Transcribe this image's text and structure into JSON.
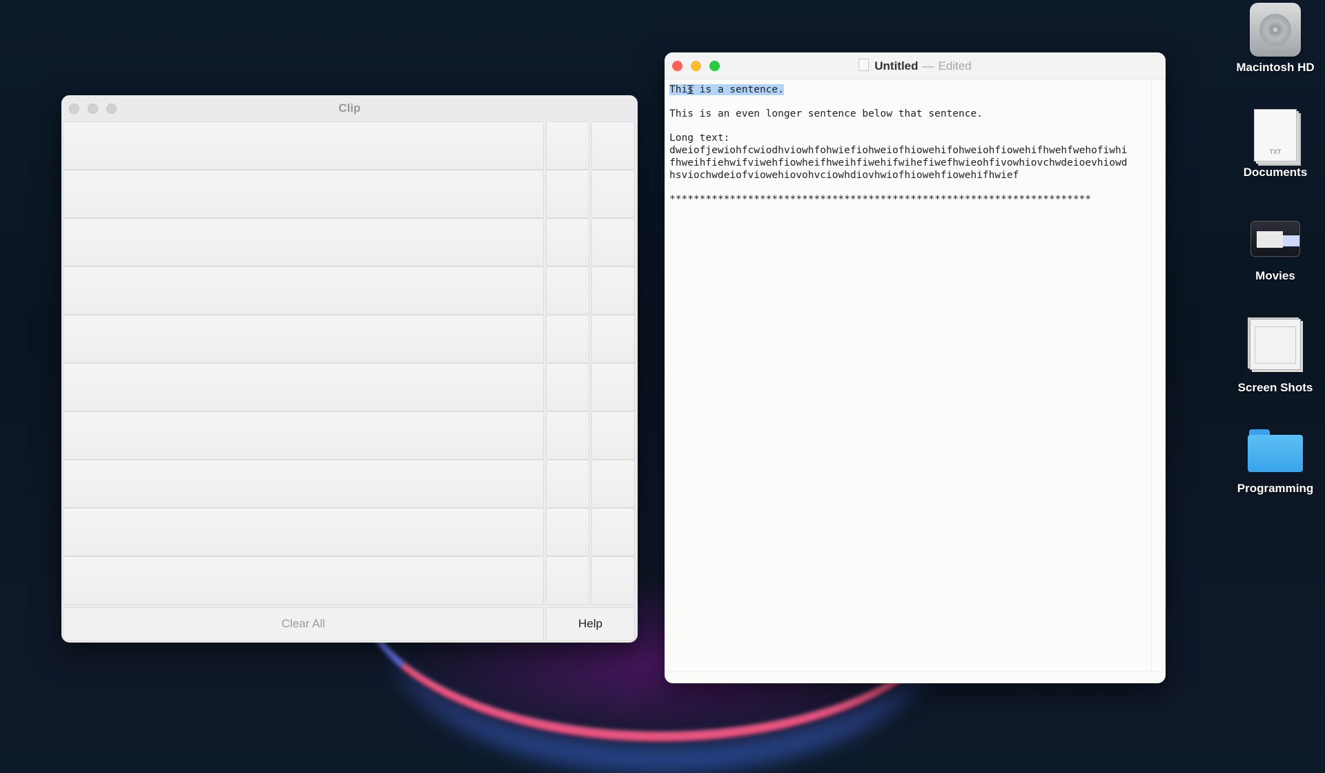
{
  "clip_window": {
    "title": "Clip",
    "rows": 10,
    "clear_all_label": "Clear All",
    "help_label": "Help"
  },
  "textedit_window": {
    "title": "Untitled",
    "separator": "—",
    "state": "Edited",
    "lines": {
      "line1_selected": "This is a sentence.",
      "line2": "This is an even longer sentence below that sentence.",
      "line3": "Long text:",
      "line4": "dweiofjewiohfcwiodhviowhfohwiefiohweiofhiowehifohweiohfiowehifhwehfwehofiwhi",
      "line5": "fhweihfiehwifviwehfiowheifhweihfiwehifwihefiwefhwieohfivowhiovchwdeioevhiowd",
      "line6": "hsviochwdeiofviowehiovohvciowhdiovhwiofhiowehfiowehifhwief",
      "line7": "**********************************************************************"
    }
  },
  "desktop": {
    "items": [
      {
        "label": "Macintosh HD",
        "icon": "hard-drive-icon"
      },
      {
        "label": "Documents",
        "icon": "text-document-icon"
      },
      {
        "label": "Movies",
        "icon": "movie-folder-icon"
      },
      {
        "label": "Screen Shots",
        "icon": "screenshot-stack-icon"
      },
      {
        "label": "Programming",
        "icon": "blue-folder-icon"
      }
    ],
    "doc_icon_text": "TXT"
  },
  "colors": {
    "selection": "#b3d3f7",
    "close": "#fe5f57",
    "minimize": "#febc2e",
    "zoom": "#28c840",
    "folder": "#3aa4ea"
  }
}
